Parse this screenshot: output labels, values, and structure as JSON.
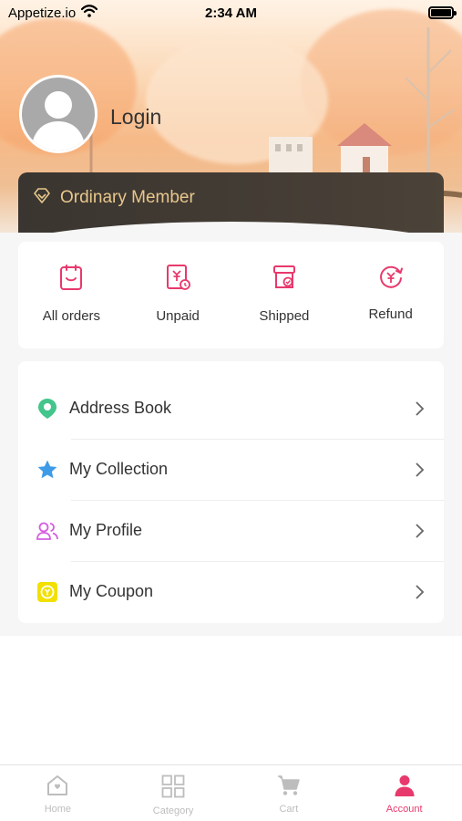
{
  "status_bar": {
    "carrier": "Appetize.io",
    "time": "2:34 AM"
  },
  "profile": {
    "login_label": "Login",
    "member_level": "Ordinary Member"
  },
  "orders": [
    {
      "label": "All orders",
      "icon": "clipboard-icon"
    },
    {
      "label": "Unpaid",
      "icon": "yen-bill-icon"
    },
    {
      "label": "Shipped",
      "icon": "box-check-icon"
    },
    {
      "label": "Refund",
      "icon": "yen-refund-icon"
    }
  ],
  "menu": [
    {
      "label": "Address Book",
      "icon": "location-pin-icon"
    },
    {
      "label": "My Collection",
      "icon": "star-icon"
    },
    {
      "label": "My Profile",
      "icon": "people-icon"
    },
    {
      "label": "My Coupon",
      "icon": "coupon-icon"
    }
  ],
  "tabs": [
    {
      "label": "Home",
      "icon": "home-icon",
      "active": false
    },
    {
      "label": "Category",
      "icon": "grid-icon",
      "active": false
    },
    {
      "label": "Cart",
      "icon": "cart-icon",
      "active": false
    },
    {
      "label": "Account",
      "icon": "person-icon",
      "active": true
    }
  ],
  "colors": {
    "accent": "#e8396c",
    "member_gold": "#e8c78c",
    "member_bar": "#3f3933",
    "tab_inactive": "#bdbdbd"
  }
}
